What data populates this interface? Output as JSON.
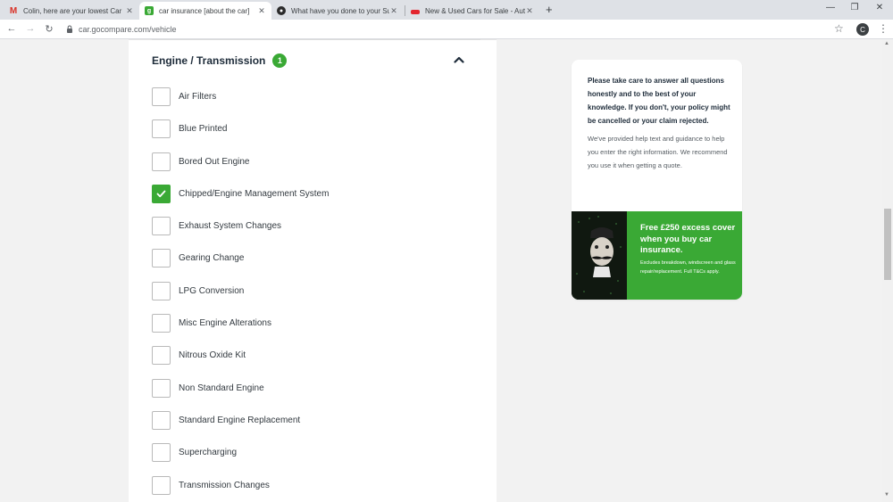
{
  "browser": {
    "tabs": [
      {
        "title": "Colin, here are your lowest Car In",
        "favicon": "gmail-icon"
      },
      {
        "title": "car insurance [about the car]",
        "favicon": "gocompare-icon"
      },
      {
        "title": "What have you done to your Sup",
        "favicon": "pistonheads-icon"
      },
      {
        "title": "New & Used Cars for Sale - Auto",
        "favicon": "autotrader-icon"
      }
    ],
    "url": "car.gocompare.com/vehicle",
    "profile_initial": "C"
  },
  "section": {
    "title": "Engine / Transmission",
    "count": "1"
  },
  "options": [
    {
      "label": "Air Filters",
      "checked": false
    },
    {
      "label": "Blue Printed",
      "checked": false
    },
    {
      "label": "Bored Out Engine",
      "checked": false
    },
    {
      "label": "Chipped/Engine Management System",
      "checked": true
    },
    {
      "label": "Exhaust System Changes",
      "checked": false
    },
    {
      "label": "Gearing Change",
      "checked": false
    },
    {
      "label": "LPG Conversion",
      "checked": false
    },
    {
      "label": "Misc Engine Alterations",
      "checked": false
    },
    {
      "label": "Nitrous Oxide Kit",
      "checked": false
    },
    {
      "label": "Non Standard Engine",
      "checked": false
    },
    {
      "label": "Standard Engine Replacement",
      "checked": false
    },
    {
      "label": "Supercharging",
      "checked": false
    },
    {
      "label": "Transmission Changes",
      "checked": false
    }
  ],
  "sidebar": {
    "notice_strong": "Please take care to answer all questions honestly and to the best of your knowledge. If you don't, your policy might be cancelled or your claim rejected.",
    "notice_normal": "We've provided help text and guidance to help you enter the right information. We recommend you use it when getting a quote.",
    "promo_headline": "Free £250 excess cover when you buy car insurance.",
    "promo_small": "Excludes breakdown, windscreen and glass repair/replacement. Full T&Cs apply."
  },
  "colors": {
    "accent_green": "#3aa935",
    "heading": "#1e2c3a"
  }
}
